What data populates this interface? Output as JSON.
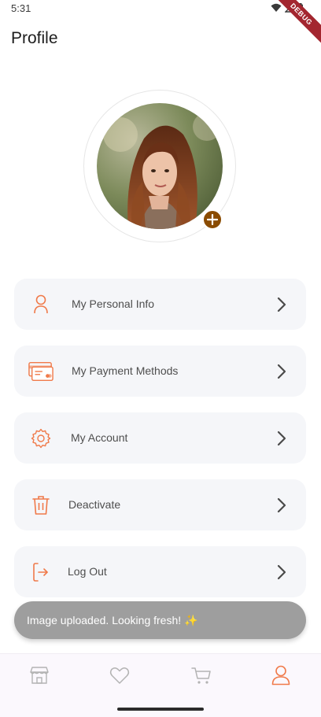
{
  "status_bar": {
    "time": "5:31",
    "debug_label": "DEBUG"
  },
  "header": {
    "title": "Profile"
  },
  "profile": {
    "avatar_alt": "profile photo"
  },
  "menu": {
    "items": [
      {
        "label": "My Personal Info",
        "icon": "user-icon"
      },
      {
        "label": "My Payment Methods",
        "icon": "credit-card-icon"
      },
      {
        "label": "My Account",
        "icon": "gear-icon"
      },
      {
        "label": "Deactivate",
        "icon": "trash-icon"
      },
      {
        "label": "Log Out",
        "icon": "logout-icon"
      }
    ]
  },
  "snackbar": {
    "message": "Image uploaded. Looking fresh! ✨"
  },
  "bottom_nav": {
    "items": [
      {
        "icon": "shop-icon"
      },
      {
        "icon": "heart-icon"
      },
      {
        "icon": "cart-icon"
      },
      {
        "icon": "profile-icon",
        "active": true
      }
    ]
  },
  "colors": {
    "accent": "#F07A4A",
    "add_button": "#8A4B00",
    "card_bg": "#F5F6F9",
    "snackbar_bg": "#9E9E9E",
    "debug_ribbon": "#A3262F"
  }
}
